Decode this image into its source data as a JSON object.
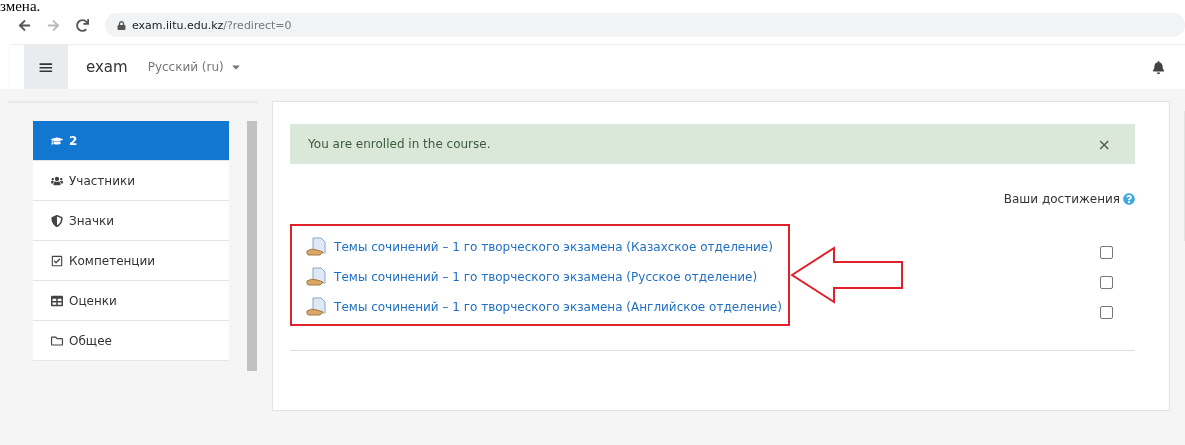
{
  "document_text": "змена.",
  "browser": {
    "url_host": "exam.iitu.edu.kz",
    "url_path": "/?redirect=0"
  },
  "navbar": {
    "menu_glyph": "≡",
    "site_name": "exam",
    "language": "Русский (ru)"
  },
  "sidebar": {
    "items": [
      {
        "label": "2",
        "selected": true
      },
      {
        "label": "Участники",
        "selected": false
      },
      {
        "label": "Значки",
        "selected": false
      },
      {
        "label": "Компетенции",
        "selected": false
      },
      {
        "label": "Оценки",
        "selected": false
      },
      {
        "label": "Общее",
        "selected": false
      }
    ]
  },
  "alert": {
    "message": "You are enrolled in the course.",
    "close": "×"
  },
  "progress_label": "Ваши достижения",
  "activities": [
    {
      "title": "Темы сочинений – 1 го творческого экзамена (Казахское отделение)",
      "checked": false
    },
    {
      "title": "Темы сочинений – 1 го творческого экзамена (Русское отделение)",
      "checked": false
    },
    {
      "title": "Темы сочинений – 1 го творческого экзамена (Английское отделение)",
      "checked": false
    }
  ]
}
